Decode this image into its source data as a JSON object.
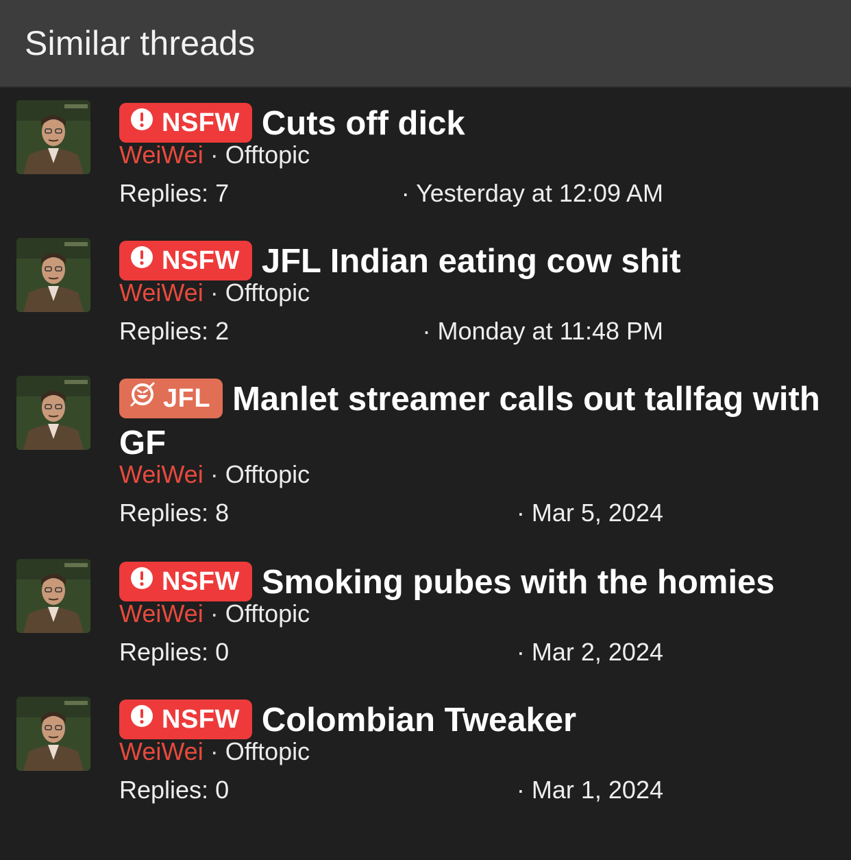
{
  "header": {
    "title": "Similar threads"
  },
  "threads": [
    {
      "badge": {
        "type": "nsfw",
        "label": "NSFW",
        "icon": "alert-icon",
        "color": "#ee3a3a"
      },
      "title": "Cuts off dick",
      "author": "WeiWei",
      "separator": "·",
      "forum": "Offtopic",
      "replies_label": "Replies: 7",
      "date": "· Yesterday at 12:09 AM"
    },
    {
      "badge": {
        "type": "nsfw",
        "label": "NSFW",
        "icon": "alert-icon",
        "color": "#ee3a3a"
      },
      "title": "JFL Indian eating cow shit",
      "author": "WeiWei",
      "separator": "·",
      "forum": "Offtopic",
      "replies_label": "Replies: 2",
      "date": "· Monday at 11:48 PM"
    },
    {
      "badge": {
        "type": "jfl",
        "label": "JFL",
        "icon": "laugh-icon",
        "color": "#e16f55"
      },
      "title": "Manlet streamer calls out tallfag with GF",
      "author": "WeiWei",
      "separator": "·",
      "forum": "Offtopic",
      "replies_label": "Replies: 8",
      "date": "· Mar 5, 2024"
    },
    {
      "badge": {
        "type": "nsfw",
        "label": "NSFW",
        "icon": "alert-icon",
        "color": "#ee3a3a"
      },
      "title": "Smoking pubes with the homies",
      "author": "WeiWei",
      "separator": "·",
      "forum": "Offtopic",
      "replies_label": "Replies: 0",
      "date": "· Mar 2, 2024"
    },
    {
      "badge": {
        "type": "nsfw",
        "label": "NSFW",
        "icon": "alert-icon",
        "color": "#ee3a3a"
      },
      "title": "Colombian Tweaker",
      "author": "WeiWei",
      "separator": "·",
      "forum": "Offtopic",
      "replies_label": "Replies: 0",
      "date": "· Mar 1, 2024"
    }
  ],
  "colors": {
    "author": "#e84a3d",
    "background": "#1f1f1f",
    "header_bg": "#3d3d3d"
  }
}
